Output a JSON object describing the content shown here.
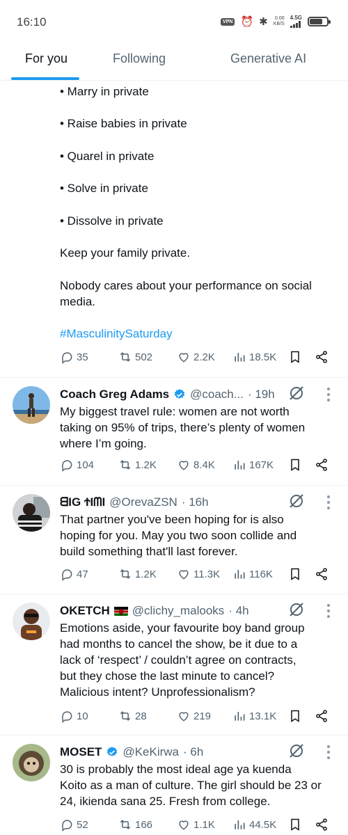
{
  "status_bar": {
    "time": "16:10",
    "vpn_label": "VPN",
    "speed_value": "0.00",
    "speed_unit": "KB/S",
    "network_label": "4.5G",
    "battery_level": 0.75
  },
  "tabs": [
    {
      "label": "For you",
      "active": true
    },
    {
      "label": "Following",
      "active": false
    },
    {
      "label": "Generative AI",
      "active": false
    }
  ],
  "partial_tweet": {
    "lines": [
      "• Marry in private",
      "• Raise babies in private",
      "• Quarel in private",
      "• Solve in private",
      "• Dissolve in private",
      "Keep your family private.",
      "Nobody cares about your performance on social",
      "media."
    ],
    "hashtag": "#MasculinitySaturday",
    "stats": {
      "replies": "35",
      "retweets": "502",
      "likes": "2.2K",
      "views": "18.5K"
    }
  },
  "tweets": [
    {
      "name": "Coach Greg Adams",
      "verified": true,
      "handle": "@coach...",
      "time": "· 19h",
      "lines": [
        "My biggest travel rule: women are not worth",
        "taking on 95% of trips, there’s plenty of women",
        "where I’m going."
      ],
      "stats": {
        "replies": "104",
        "retweets": "1.2K",
        "likes": "8.4K",
        "views": "167K"
      }
    },
    {
      "name": "ᗺIG ϮIᗰI",
      "verified": false,
      "handle": "@OrevaZSN",
      "time": "· 16h",
      "lines": [
        "That partner you've been hoping for is also",
        "hoping for you. May you two soon collide and",
        "build something that'll last forever."
      ],
      "stats": {
        "replies": "47",
        "retweets": "1.2K",
        "likes": "11.3K",
        "views": "116K"
      }
    },
    {
      "name": "OKETCH",
      "verified": false,
      "handle": "@clichy_malooks",
      "time": "· 4h",
      "lines": [
        "Emotions aside, your favourite boy band group",
        "had months to cancel the show, be it due to a",
        "lack of ‘respect’ / couldn’t agree on contracts,",
        "but they chose the last minute to cancel?",
        "Malicious intent? Unprofessionalism?"
      ],
      "stats": {
        "replies": "10",
        "retweets": "28",
        "likes": "219",
        "views": "13.1K"
      }
    },
    {
      "name": "MOSET",
      "verified": true,
      "handle": "@KeKirwa",
      "time": "· 6h",
      "lines": [
        "30 is probably the most ideal age ya kuenda",
        "Koito as a man of culture. The girl should be 23 or",
        "24, ikienda sana 25. Fresh from college."
      ],
      "stats": {
        "replies": "52",
        "retweets": "166",
        "likes": "1.1K",
        "views": "44.5K"
      }
    }
  ],
  "colors": {
    "accent": "#1d9bf0",
    "text": "#0f1419",
    "muted": "#536471",
    "divider": "#eff3f4"
  }
}
